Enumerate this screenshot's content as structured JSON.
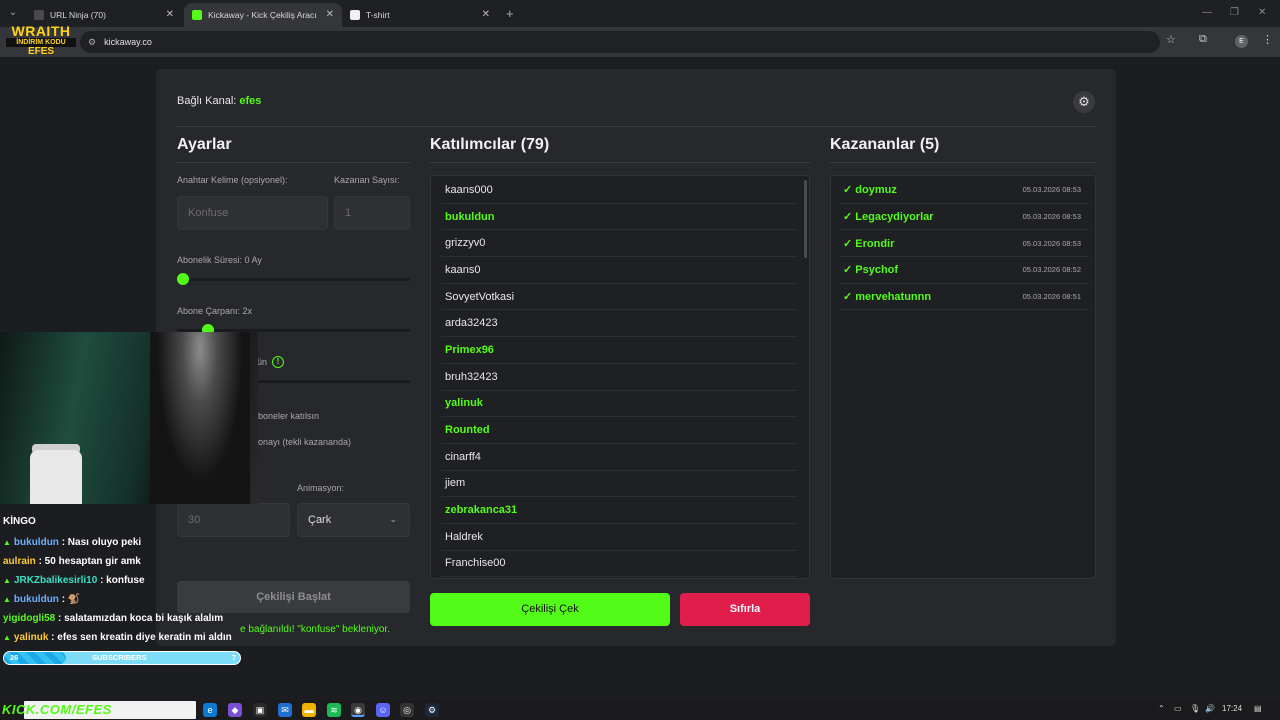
{
  "browser": {
    "tabs": [
      {
        "title": "URL Ninja (70)",
        "active": false
      },
      {
        "title": "Kickaway - Kick Çekiliş Aracı",
        "active": true
      },
      {
        "title": "T-shirt",
        "active": false
      }
    ],
    "url": "kickaway.co",
    "profile_initial": "E"
  },
  "app": {
    "channel_label": "Bağlı Kanal:",
    "channel_name": "efes",
    "settings": {
      "title": "Ayarlar",
      "keyword_label": "Anahtar Kelime (opsiyonel):",
      "keyword_placeholder": "Konfuse",
      "winner_count_label": "Kazanan Sayısı:",
      "winner_count_placeholder": "1",
      "sub_duration_label": "Abonelik Süresi: 0 Ay",
      "sub_multiplier_label": "Abone Çarpanı: 2x",
      "partial_label_1": "ün",
      "partial_label_2": "boneler katılsın",
      "partial_label_3": "onayı (tekli kazananda)",
      "animation_label": "Animasyon:",
      "timer_placeholder": "30",
      "animation_value": "Çark",
      "start_button": "Çekilişi Başlat",
      "status_message": "e bağlanıldı! \"konfuse\" bekleniyor."
    },
    "participants": {
      "title": "Katılımcılar (79)",
      "items": [
        {
          "name": "kaans000",
          "sub": false
        },
        {
          "name": "bukuldun",
          "sub": true
        },
        {
          "name": "grizzyv0",
          "sub": false
        },
        {
          "name": "kaans0",
          "sub": false
        },
        {
          "name": "SovyetVotkasi",
          "sub": false
        },
        {
          "name": "arda32423",
          "sub": false
        },
        {
          "name": "Primex96",
          "sub": true
        },
        {
          "name": "bruh32423",
          "sub": false
        },
        {
          "name": "yalinuk",
          "sub": true
        },
        {
          "name": "Rounted",
          "sub": true
        },
        {
          "name": "cinarff4",
          "sub": false
        },
        {
          "name": "jiem",
          "sub": false
        },
        {
          "name": "zebrakanca31",
          "sub": true
        },
        {
          "name": "Haldrek",
          "sub": false
        },
        {
          "name": "Franchise00",
          "sub": false
        }
      ]
    },
    "winners": {
      "title": "Kazananlar (5)",
      "items": [
        {
          "name": "✓ doymuz",
          "date": "05.03.2026 08:53"
        },
        {
          "name": "✓ Legacydiyorlar",
          "date": "05.03.2026 08:53"
        },
        {
          "name": "✓ Erondir",
          "date": "05.03.2026 08:53"
        },
        {
          "name": "✓ Psychof",
          "date": "05.03.2026 08:52"
        },
        {
          "name": "✓ mervehatunnn",
          "date": "05.03.2026 08:51"
        }
      ]
    },
    "draw_button": "Çekilişi Çek",
    "reset_button": "Sıfırla"
  },
  "overlay": {
    "brand_line1": "WRAITH",
    "brand_line2": "İNDİRİM KODU",
    "brand_line3": "EFES",
    "chat_header": "KİNGO",
    "chat": [
      {
        "user": "bukuldun",
        "msg": " : Nası oluyo peki",
        "color": "u-blue",
        "badge": true
      },
      {
        "user": "aulrain",
        "msg": " : 50 hesaptan gir amk",
        "color": "u-yellow",
        "badge": false
      },
      {
        "user": "JRKZbalikesirli10",
        "msg": " : konfuse",
        "color": "u-cyan",
        "badge": true
      },
      {
        "user": "bukuldun",
        "msg": " : 🐒",
        "color": "u-blue",
        "badge": true
      },
      {
        "user": "yigidogli58",
        "msg": " : salatamızdan koca bi kaşık alalım",
        "color": "u-green",
        "badge": false
      },
      {
        "user": "yalinuk",
        "msg": " : efes sen kreatin diye keratin mi aldın",
        "color": "u-yellow",
        "badge": true
      }
    ],
    "sub_goal_current": "26",
    "sub_goal_label": "SUBSCRIBERS",
    "sub_goal_target": "7",
    "kick_url": "KICK.COM/EFES"
  },
  "taskbar": {
    "time": "17:24"
  }
}
